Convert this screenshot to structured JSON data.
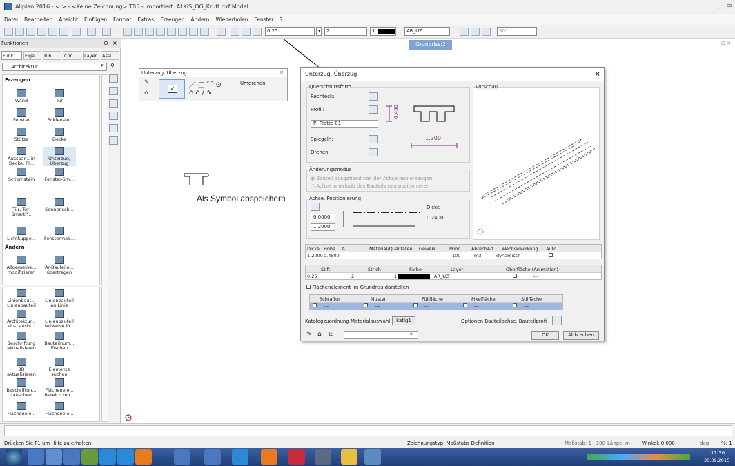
{
  "window": {
    "title": "Allplan 2016 - <   > - <Keine Zeichnung> TB5 - Importiert: ALKIS_OG_Kruft.dxf Model",
    "min": "_",
    "restore": "▭"
  },
  "menu": [
    "Datei",
    "Bearbeiten",
    "Ansicht",
    "Einfügen",
    "Format",
    "Extras",
    "Erzeugen",
    "Ändern",
    "Wiederholen",
    "Fenster",
    "?"
  ],
  "toolbar": {
    "pen": "0.25",
    "line": "2",
    "color": "1",
    "layer": "AR_UZ",
    "scale": "301"
  },
  "view_tab": "Grundriss:2",
  "left": {
    "title": "Funktionen",
    "pin": "⊕",
    "close": "×",
    "tabs": [
      "Funk...",
      "Eige...",
      "Bibl...",
      "Con...",
      "Layer",
      "Assi..."
    ],
    "module": "Architektur",
    "erzeugen": "Erzeugen",
    "aendern": "Ändern",
    "items1": [
      "Wand",
      "Tür",
      "Fenster",
      "Eckfenster",
      "Stütze",
      "Decke",
      "Ausspar... in Decke, Pl...",
      "Unterzug, Überzug",
      "Schornstein",
      "Fenster-Sm...",
      "Tür, Tor-SmartP...",
      "Sonnensch...",
      "Lichtkuppe...",
      "Fenstermak..."
    ],
    "items2": [
      "Allgemeine... modifizieren",
      "Ar-Bauteile... übertragen",
      "Linienbaut... Linienbauteil",
      "Linienbauteil an Linie",
      "Architektur... ein-, ausbl...",
      "Linienbauteil teilweise lö...",
      "Beschriftung aktualisieren",
      "Bauteilnum... löschen",
      "3D aktualisieren",
      "Elemente suchen",
      "Beschriftun... tauschen",
      "Flächenele... Bereich mo...",
      "Flächenele...",
      "Flächenele..."
    ]
  },
  "smallpal": {
    "title": "Unterzug, Überzug",
    "close": "×",
    "umdrehen": "Umdrehen"
  },
  "canvas_text": "Als Symbol abspeichern",
  "dialog": {
    "title": "Unterzug, Überzug",
    "close": "×",
    "querschnitt": "Querschnittsform",
    "vorschau": "Vorschau",
    "rechteck": "Rechteck:",
    "profil": "Profil:",
    "profil_value": "PI-Platte 01",
    "dim_h": "0.450",
    "dim_w": "1.200",
    "spiegeln": "Spiegeln:",
    "drehen": "Drehen:",
    "aenderungsmodus": "Änderungsmodus",
    "radio1": "Bauteil ausgehend von der Achse neu erzeugen",
    "radio2": "Achse innerhalb des Bauteils neu positionieren",
    "achse": "Achse, Positionierung",
    "achse_v1": "0.0000",
    "achse_v2": "1.2000",
    "dicke_label": "Dicke",
    "dicke_value": "0.2400",
    "grid1_headers": [
      "Dicke",
      "Höhe",
      "",
      "Material/Qualitäten",
      "Gewerk",
      "Priori...",
      "AbrechArt",
      "Wechselwirkung",
      "Auto..."
    ],
    "grid1_row": [
      "1.2000",
      "0.4500",
      "",
      "",
      "---",
      "100",
      "m3",
      "dynamisch",
      ""
    ],
    "grid2_headers": [
      "Stift",
      "Strich",
      "Farbe",
      "Layer",
      "Oberfläche (Animation)"
    ],
    "grid2_row": [
      "0.25",
      "2",
      "1",
      "AR_UZ",
      "---"
    ],
    "flaechen_chk": "Flächenelement im Grundriss darstellen",
    "grid3_headers": [
      "Schraffur",
      "Muster",
      "Füllfläche",
      "Pixelfläche",
      "Stilfläche"
    ],
    "grid3_row": [
      "---",
      "---",
      "---",
      "---",
      "---"
    ],
    "katalog_label": "Katalogzuordnung Materialauswahl",
    "katalog_btn": "katlg1",
    "optionen": "Optionen Bauteilachse, Bauteilprofi",
    "ok": "OK",
    "cancel": "Abbrechen"
  },
  "status": {
    "help": "Drücken Sie F1 um Hilfe zu erhalten.",
    "zeichnungstyp": "Zeichnungstyp: Maßstabs-Definition",
    "massstab": "Maßstab: 1 : 100",
    "laenge": "Länge: m",
    "winkel": "Winkel: 0.000",
    "deg": "deg",
    "pct": "%: 1"
  },
  "clock": {
    "time": "11:36",
    "date": "30.09.2015"
  }
}
